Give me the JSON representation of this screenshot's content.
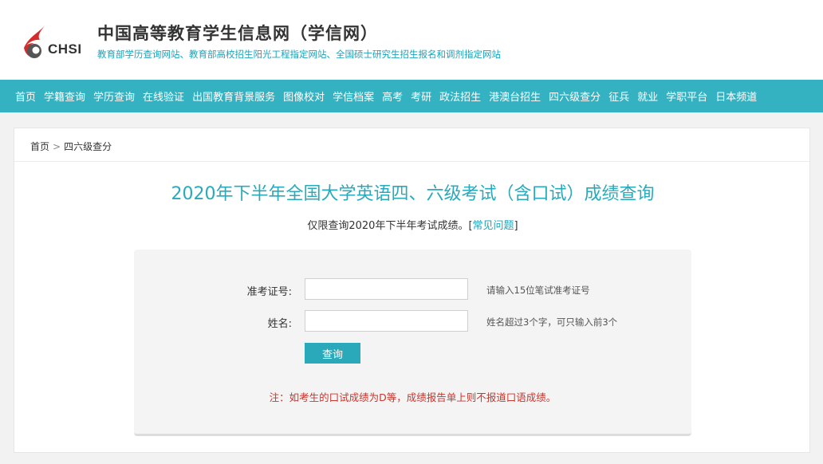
{
  "header": {
    "logo_text": "CHSI",
    "title": "中国高等教育学生信息网（学信网）",
    "subtitle": "教育部学历查询网站、教育部高校招生阳光工程指定网站、全国硕士研究生招生报名和调剂指定网站"
  },
  "nav": {
    "items": [
      "首页",
      "学籍查询",
      "学历查询",
      "在线验证",
      "出国教育背景服务",
      "图像校对",
      "学信档案",
      "高考",
      "考研",
      "政法招生",
      "港澳台招生",
      "四六级查分",
      "征兵",
      "就业",
      "学职平台",
      "日本频道"
    ]
  },
  "breadcrumb": {
    "home": "首页",
    "separator": ">",
    "current": "四六级查分"
  },
  "page": {
    "title": "2020年下半年全国大学英语四、六级考试（含口试）成绩查询",
    "subtitle_text": "仅限查询2020年下半年考试成绩。",
    "subtitle_link_open": "[",
    "subtitle_link": "常见问题",
    "subtitle_link_close": "]"
  },
  "form": {
    "ticket_label": "准考证号:",
    "ticket_value": "",
    "ticket_hint": "请输入15位笔试准考证号",
    "name_label": "姓名:",
    "name_value": "",
    "name_hint": "姓名超过3个字，可只输入前3个",
    "submit_label": "查询",
    "note": "注：如考生的口试成绩为D等，成绩报告单上则不报道口语成绩。"
  },
  "colors": {
    "accent": "#34b2c2",
    "title": "#2aa9ba",
    "warning": "#c9362d",
    "logo_red": "#d62b2b"
  },
  "icons": {
    "logo": "chsi-flame-logo"
  }
}
